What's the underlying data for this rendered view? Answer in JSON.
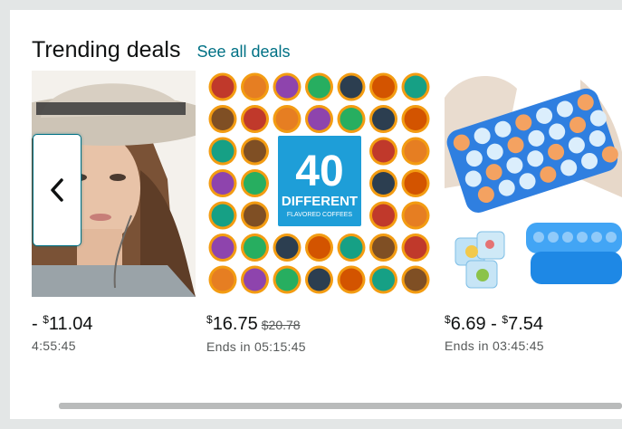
{
  "section": {
    "title": "Trending deals",
    "see_all_label": "See all deals"
  },
  "deals": [
    {
      "price_prefix": "- ",
      "currency": "$",
      "price": "11.04",
      "timer": "4:55:45"
    },
    {
      "currency": "$",
      "price": "16.75",
      "list_price": "$20.78",
      "timer_label": "Ends in",
      "timer": "05:15:45",
      "image_text": {
        "number": "40",
        "line1": "DIFFERENT",
        "line2": "FLAVORED COFFEES"
      }
    },
    {
      "currency_low": "$",
      "price_low": "6.69",
      "separator": " - ",
      "currency_high": "$",
      "price_high": "7.54",
      "timer_label": "Ends in",
      "timer": "03:45:45"
    }
  ],
  "controls": {
    "prev_icon": "chevron-left-icon"
  },
  "colors": {
    "link": "#007185",
    "background": "#e3e6e6",
    "card": "#ffffff",
    "text": "#0f1111",
    "muted": "#565959"
  }
}
